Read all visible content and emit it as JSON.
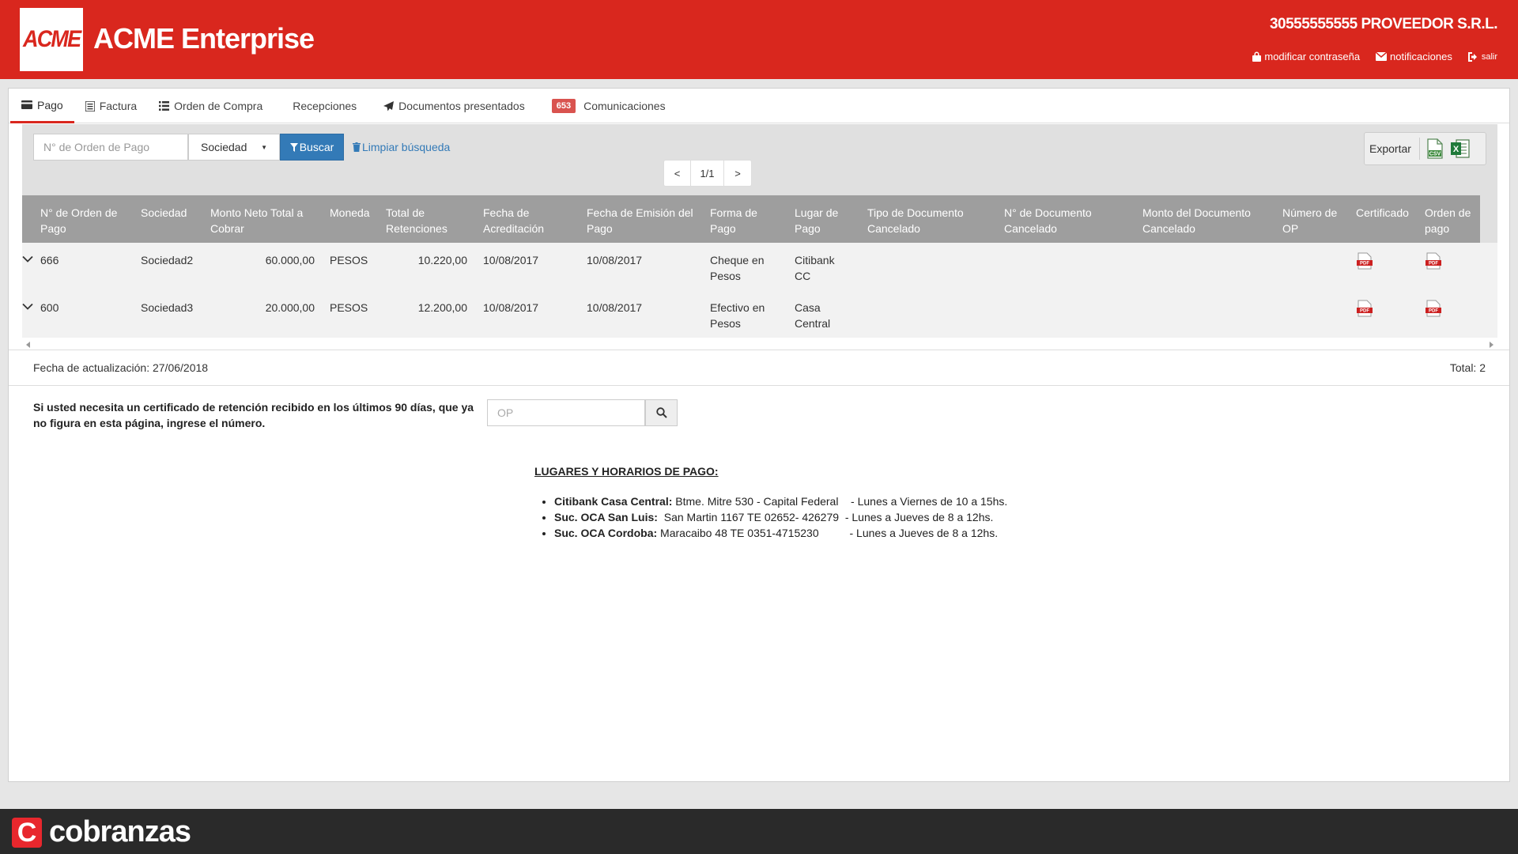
{
  "header": {
    "logo": "ACME",
    "title": "ACME Enterprise",
    "company": "30555555555 PROVEEDOR S.R.L.",
    "links": {
      "password": "modificar contraseña",
      "notifications": "notificaciones",
      "logout": "salir"
    }
  },
  "tabs": [
    {
      "label": "Pago",
      "icon": "credit-card-icon",
      "active": true
    },
    {
      "label": "Factura",
      "icon": "document-icon"
    },
    {
      "label": "Orden de Compra",
      "icon": "list-icon"
    },
    {
      "label": "Recepciones",
      "icon": ""
    },
    {
      "label": "Documentos presentados",
      "icon": "paper-plane-icon"
    },
    {
      "label": "Comunicaciones",
      "badge": "653"
    }
  ],
  "filters": {
    "order_placeholder": "N° de Orden  de Pago",
    "sociedad": "Sociedad",
    "search_button": "Buscar",
    "clear": "Limpiar búsqueda"
  },
  "pager": {
    "prev": "<",
    "page": "1/1",
    "next": ">"
  },
  "export": {
    "label": "Exportar",
    "csv_icon": "csv-file-icon",
    "excel_icon": "excel-file-icon"
  },
  "table": {
    "columns": [
      [
        "N° de Orden de",
        "Pago"
      ],
      [
        "Sociedad",
        ""
      ],
      [
        "Monto Neto Total a",
        "Cobrar"
      ],
      [
        "Moneda",
        ""
      ],
      [
        "Total de",
        "Retenciones"
      ],
      [
        "Fecha de",
        "Acreditación"
      ],
      [
        "Fecha de Emisión del",
        "Pago"
      ],
      [
        "Forma de",
        "Pago"
      ],
      [
        "Lugar de",
        "Pago"
      ],
      [
        "Tipo de Documento",
        "Cancelado"
      ],
      [
        "N° de Documento",
        "Cancelado"
      ],
      [
        "Monto del Documento",
        "Cancelado"
      ],
      [
        "Número de",
        "OP"
      ],
      [
        "Certificado",
        ""
      ],
      [
        "Orden de",
        "pago"
      ]
    ],
    "rows": [
      {
        "orden": "666",
        "sociedad": "Sociedad2",
        "monto": "60.000,00",
        "moneda": "PESOS",
        "retenciones": "10.220,00",
        "acreditacion": "10/08/2017",
        "emision": "10/08/2017",
        "forma": [
          "Cheque en",
          "Pesos"
        ],
        "lugar": [
          "Citibank",
          "CC"
        ]
      },
      {
        "orden": "600",
        "sociedad": "Sociedad3",
        "monto": "20.000,00",
        "moneda": "PESOS",
        "retenciones": "12.200,00",
        "acreditacion": "10/08/2017",
        "emision": "10/08/2017",
        "forma": [
          "Efectivo en",
          "Pesos"
        ],
        "lugar": [
          "Casa",
          "Central"
        ]
      }
    ]
  },
  "footer": {
    "fecha": "Fecha de actualización: 27/06/2018",
    "total": "Total: 2"
  },
  "certificate": {
    "text": "Si usted necesita un certificado de retención recibido en los últimos 90 días, que ya no figura en esta página, ingrese el número.",
    "placeholder": "OP"
  },
  "lugares": {
    "title": "LUGARES Y HORARIOS DE PAGO:",
    "items": [
      {
        "name": "Citibank Casa Central:",
        "address": " Btme. Mitre 530 - Capital Federal",
        "hours": "    - Lunes a Viernes de 10 a 15hs."
      },
      {
        "name": "Suc. OCA  San Luis:",
        "address": "  San Martin 1167 TE 02652- 426279",
        "hours": "  - Lunes a Jueves de 8 a 12hs."
      },
      {
        "name": "Suc. OCA Cordoba:",
        "address": " Maracaibo 48 TE 0351-4715230",
        "hours": "          - Lunes a Jueves de 8 a 12hs."
      }
    ]
  },
  "brand": {
    "name": "cobranzas",
    "icon_letter": "C"
  },
  "colors": {
    "primary": "#d9271e",
    "link": "#337ab7",
    "header_gray": "#9e9e9e",
    "footer_dark": "#2a2a2a"
  }
}
